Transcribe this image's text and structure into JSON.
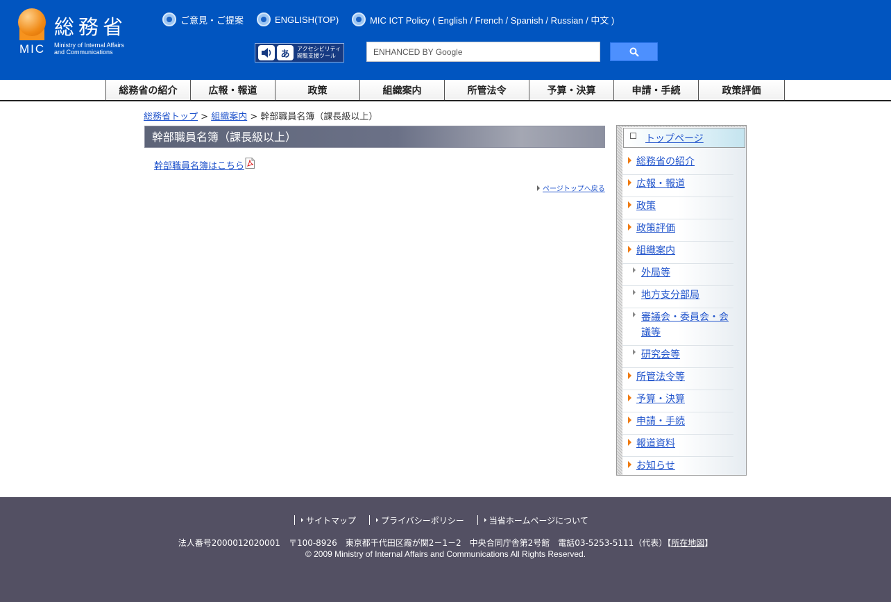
{
  "header": {
    "logo_kanji": "総務省",
    "logo_abbr": "MIC",
    "logo_sub_line1": "Ministry of Internal Affairs",
    "logo_sub_line2": "and Communications",
    "top_links": [
      {
        "label": "ご意見・ご提案"
      },
      {
        "label": "ENGLISH(TOP)"
      },
      {
        "label": "MIC ICT Policy ( English / French / Spanish / Russian / 中文 )"
      }
    ],
    "accessibility": {
      "icon_text": "あ",
      "label_line1": "アクセシビリティ",
      "label_line2": "閲覧支援ツール"
    },
    "search": {
      "placeholder": "ENHANCED BY Google"
    }
  },
  "global_nav": [
    "総務省の紹介",
    "広報・報道",
    "政策",
    "組織案内",
    "所管法令",
    "予算・決算",
    "申請・手続",
    "政策評価"
  ],
  "breadcrumb": {
    "items": [
      "総務省トップ",
      "組織案内"
    ],
    "separator": ">",
    "current": "幹部職員名簿（課長級以上）"
  },
  "main": {
    "title": "幹部職員名簿（課長級以上）",
    "pdf_link": "幹部職員名簿はこちら",
    "page_top": "ページトップへ戻る"
  },
  "sidebar": {
    "top": "トップページ",
    "items": [
      {
        "label": "総務省の紹介",
        "level": 1
      },
      {
        "label": "広報・報道",
        "level": 1
      },
      {
        "label": "政策",
        "level": 1
      },
      {
        "label": "政策評価",
        "level": 1
      },
      {
        "label": "組織案内",
        "level": 1
      },
      {
        "label": "外局等",
        "level": 2
      },
      {
        "label": "地方支分部局",
        "level": 2
      },
      {
        "label": "審議会・委員会・会議等",
        "level": 2
      },
      {
        "label": "研究会等",
        "level": 2
      },
      {
        "label": "所管法令等",
        "level": 1
      },
      {
        "label": "予算・決算",
        "level": 1
      },
      {
        "label": "申請・手続",
        "level": 1
      },
      {
        "label": "報道資料",
        "level": 1
      },
      {
        "label": "お知らせ",
        "level": 1
      }
    ]
  },
  "footer": {
    "links": [
      "サイトマップ",
      "プライバシーポリシー",
      "当省ホームページについて"
    ],
    "address": "法人番号2000012020001　〒100-8926　東京都千代田区霞が関2－1－2　中央合同庁舎第2号館　電話03-5253-5111（代表）",
    "address_open": "【",
    "map_link": "所在地図",
    "address_close": "】",
    "copyright": "© 2009 Ministry of Internal Affairs and Communications All Rights Reserved."
  },
  "colors": {
    "header_bg": "#0155c0",
    "footer_bg": "#535063",
    "accent_orange": "#f7931e",
    "link": "#2255cc"
  }
}
